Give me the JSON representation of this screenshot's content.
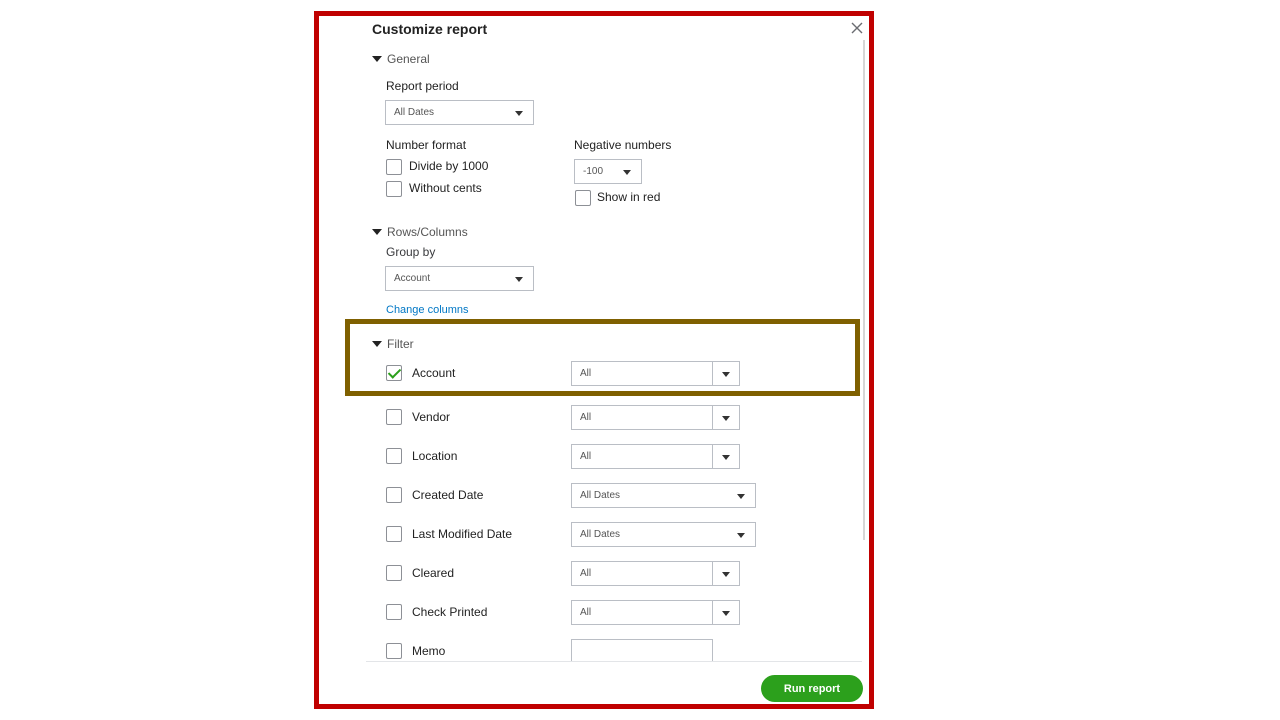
{
  "dialog": {
    "title": "Customize report",
    "run_button": "Run report"
  },
  "general": {
    "header": "General",
    "report_period_label": "Report period",
    "report_period_value": "All Dates",
    "number_format_label": "Number format",
    "divide_by_1000": "Divide by 1000",
    "without_cents": "Without cents",
    "negative_numbers_label": "Negative numbers",
    "negative_numbers_value": "-100",
    "show_in_red": "Show in red"
  },
  "rows_columns": {
    "header": "Rows/Columns",
    "group_by_label": "Group by",
    "group_by_value": "Account",
    "change_columns": "Change columns"
  },
  "filter": {
    "header": "Filter",
    "items": [
      {
        "label": "Account",
        "value": "All",
        "checked": true
      },
      {
        "label": "Vendor",
        "value": "All",
        "checked": false
      },
      {
        "label": "Location",
        "value": "All",
        "checked": false
      },
      {
        "label": "Created Date",
        "value": "All Dates",
        "checked": false
      },
      {
        "label": "Last Modified Date",
        "value": "All Dates",
        "checked": false
      },
      {
        "label": "Cleared",
        "value": "All",
        "checked": false
      },
      {
        "label": "Check Printed",
        "value": "All",
        "checked": false
      },
      {
        "label": "Memo",
        "value": "",
        "checked": false
      }
    ]
  },
  "colors": {
    "outer_frame": "#c00000",
    "highlight_frame": "#7f6000",
    "accent_green": "#2ca01c",
    "link_blue": "#0077c5"
  },
  "icons": {
    "close": "close-icon",
    "section_toggle": "triangle-down-icon",
    "dropdown": "chevron-down-icon",
    "check": "checkmark-icon"
  }
}
